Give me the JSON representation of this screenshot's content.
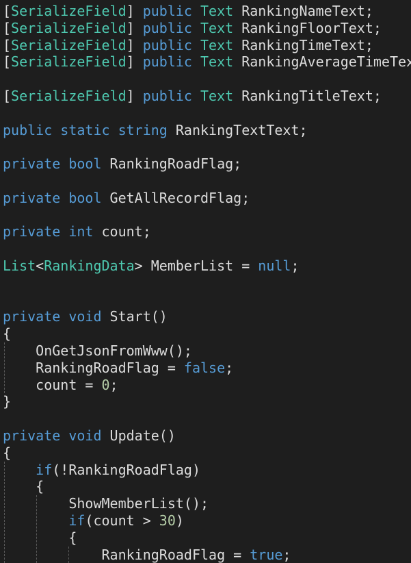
{
  "editor": {
    "theme": {
      "background": "#1e1e1e",
      "text": "#dcdcdc",
      "keyword": "#569cd6",
      "type": "#4ec9b0",
      "number": "#b5cea8",
      "indent_guide": "#5a5a5a"
    },
    "lines": [
      {
        "tokens": [
          {
            "t": "[",
            "k": "text"
          },
          {
            "t": "SerializeField",
            "k": "type"
          },
          {
            "t": "] ",
            "k": "text"
          },
          {
            "t": "public",
            "k": "kw"
          },
          {
            "t": " ",
            "k": "text"
          },
          {
            "t": "Text",
            "k": "type"
          },
          {
            "t": " RankingNameText;",
            "k": "text"
          }
        ]
      },
      {
        "tokens": [
          {
            "t": "[",
            "k": "text"
          },
          {
            "t": "SerializeField",
            "k": "type"
          },
          {
            "t": "] ",
            "k": "text"
          },
          {
            "t": "public",
            "k": "kw"
          },
          {
            "t": " ",
            "k": "text"
          },
          {
            "t": "Text",
            "k": "type"
          },
          {
            "t": " RankingFloorText;",
            "k": "text"
          }
        ]
      },
      {
        "tokens": [
          {
            "t": "[",
            "k": "text"
          },
          {
            "t": "SerializeField",
            "k": "type"
          },
          {
            "t": "] ",
            "k": "text"
          },
          {
            "t": "public",
            "k": "kw"
          },
          {
            "t": " ",
            "k": "text"
          },
          {
            "t": "Text",
            "k": "type"
          },
          {
            "t": " RankingTimeText;",
            "k": "text"
          }
        ]
      },
      {
        "tokens": [
          {
            "t": "[",
            "k": "text"
          },
          {
            "t": "SerializeField",
            "k": "type"
          },
          {
            "t": "] ",
            "k": "text"
          },
          {
            "t": "public",
            "k": "kw"
          },
          {
            "t": " ",
            "k": "text"
          },
          {
            "t": "Text",
            "k": "type"
          },
          {
            "t": " RankingAverageTimeText;",
            "k": "text"
          }
        ]
      },
      {
        "tokens": []
      },
      {
        "tokens": [
          {
            "t": "[",
            "k": "text"
          },
          {
            "t": "SerializeField",
            "k": "type"
          },
          {
            "t": "] ",
            "k": "text"
          },
          {
            "t": "public",
            "k": "kw"
          },
          {
            "t": " ",
            "k": "text"
          },
          {
            "t": "Text",
            "k": "type"
          },
          {
            "t": " RankingTitleText;",
            "k": "text"
          }
        ]
      },
      {
        "tokens": []
      },
      {
        "tokens": [
          {
            "t": "public",
            "k": "kw"
          },
          {
            "t": " ",
            "k": "text"
          },
          {
            "t": "static",
            "k": "kw"
          },
          {
            "t": " ",
            "k": "text"
          },
          {
            "t": "string",
            "k": "kw"
          },
          {
            "t": " RankingTextText;",
            "k": "text"
          }
        ]
      },
      {
        "tokens": []
      },
      {
        "tokens": [
          {
            "t": "private",
            "k": "kw"
          },
          {
            "t": " ",
            "k": "text"
          },
          {
            "t": "bool",
            "k": "kw"
          },
          {
            "t": " RankingRoadFlag;",
            "k": "text"
          }
        ]
      },
      {
        "tokens": []
      },
      {
        "tokens": [
          {
            "t": "private",
            "k": "kw"
          },
          {
            "t": " ",
            "k": "text"
          },
          {
            "t": "bool",
            "k": "kw"
          },
          {
            "t": " GetAllRecordFlag;",
            "k": "text"
          }
        ]
      },
      {
        "tokens": []
      },
      {
        "tokens": [
          {
            "t": "private",
            "k": "kw"
          },
          {
            "t": " ",
            "k": "text"
          },
          {
            "t": "int",
            "k": "kw"
          },
          {
            "t": " count;",
            "k": "text"
          }
        ]
      },
      {
        "tokens": []
      },
      {
        "tokens": [
          {
            "t": "List",
            "k": "type"
          },
          {
            "t": "<",
            "k": "text"
          },
          {
            "t": "RankingData",
            "k": "type"
          },
          {
            "t": "> MemberList = ",
            "k": "text"
          },
          {
            "t": "null",
            "k": "kw"
          },
          {
            "t": ";",
            "k": "text"
          }
        ]
      },
      {
        "tokens": []
      },
      {
        "tokens": []
      },
      {
        "tokens": [
          {
            "t": "private",
            "k": "kw"
          },
          {
            "t": " ",
            "k": "text"
          },
          {
            "t": "void",
            "k": "kw"
          },
          {
            "t": " Start()",
            "k": "text"
          }
        ]
      },
      {
        "tokens": [
          {
            "t": "{",
            "k": "text"
          }
        ]
      },
      {
        "tokens": [
          {
            "t": "    OnGetJsonFromWww();",
            "k": "text"
          }
        ]
      },
      {
        "tokens": [
          {
            "t": "    RankingRoadFlag = ",
            "k": "text"
          },
          {
            "t": "false",
            "k": "kw"
          },
          {
            "t": ";",
            "k": "text"
          }
        ]
      },
      {
        "tokens": [
          {
            "t": "    count = ",
            "k": "text"
          },
          {
            "t": "0",
            "k": "num"
          },
          {
            "t": ";",
            "k": "text"
          }
        ]
      },
      {
        "tokens": [
          {
            "t": "}",
            "k": "text"
          }
        ]
      },
      {
        "tokens": []
      },
      {
        "tokens": [
          {
            "t": "private",
            "k": "kw"
          },
          {
            "t": " ",
            "k": "text"
          },
          {
            "t": "void",
            "k": "kw"
          },
          {
            "t": " Update()",
            "k": "text"
          }
        ]
      },
      {
        "tokens": [
          {
            "t": "{",
            "k": "text"
          }
        ]
      },
      {
        "tokens": [
          {
            "t": "    ",
            "k": "text"
          },
          {
            "t": "if",
            "k": "kw"
          },
          {
            "t": "(!RankingRoadFlag)",
            "k": "text"
          }
        ]
      },
      {
        "tokens": [
          {
            "t": "    {",
            "k": "text"
          }
        ]
      },
      {
        "tokens": [
          {
            "t": "        ShowMemberList();",
            "k": "text"
          }
        ]
      },
      {
        "tokens": [
          {
            "t": "        ",
            "k": "text"
          },
          {
            "t": "if",
            "k": "kw"
          },
          {
            "t": "(count > ",
            "k": "text"
          },
          {
            "t": "30",
            "k": "num"
          },
          {
            "t": ")",
            "k": "text"
          }
        ]
      },
      {
        "tokens": [
          {
            "t": "        {",
            "k": "text"
          }
        ]
      },
      {
        "tokens": [
          {
            "t": "            RankingRoadFlag = ",
            "k": "text"
          },
          {
            "t": "true",
            "k": "kw"
          },
          {
            "t": ";",
            "k": "text"
          }
        ]
      }
    ]
  }
}
